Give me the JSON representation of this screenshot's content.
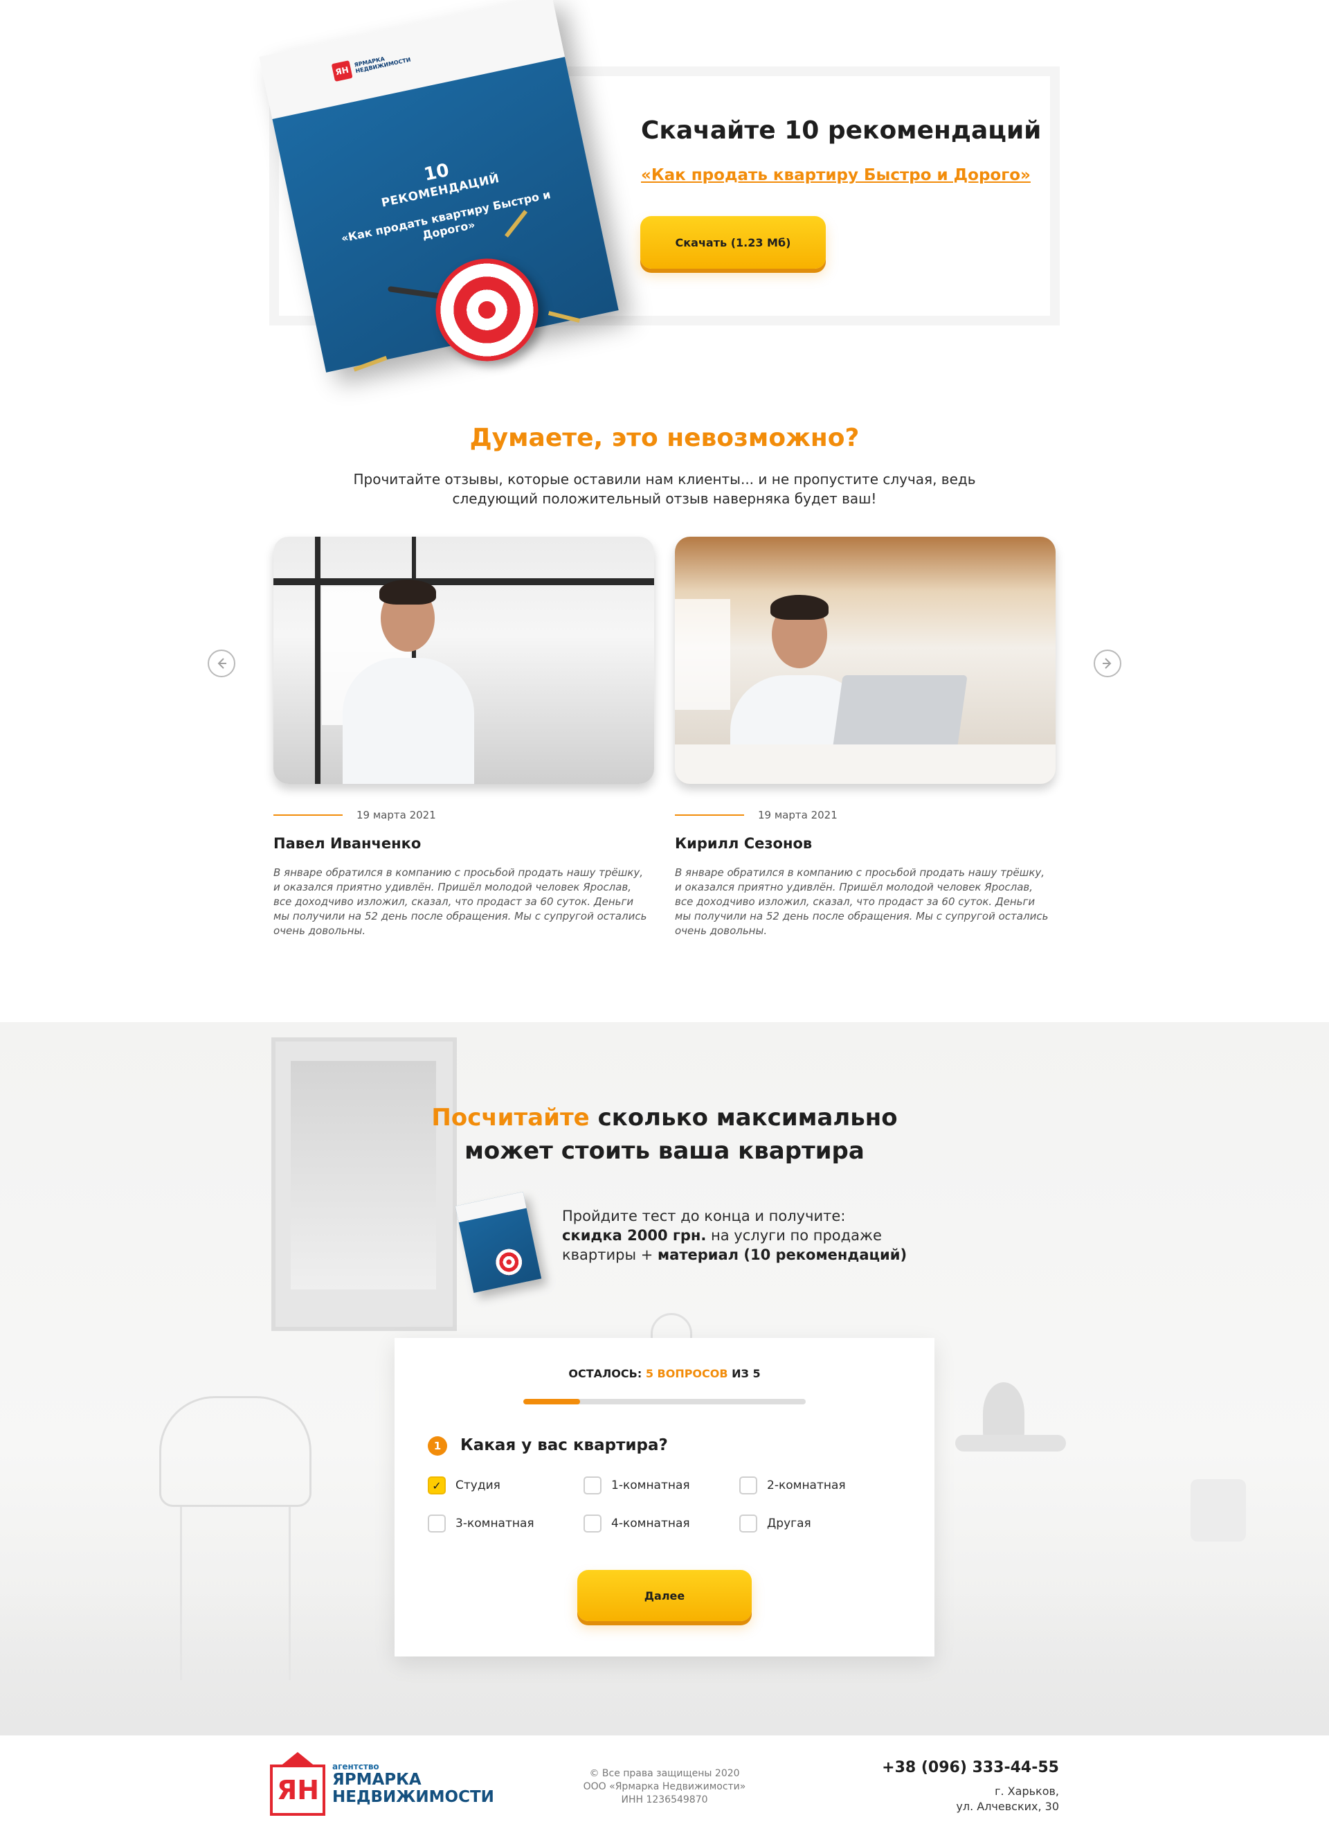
{
  "download": {
    "book": {
      "logo_letters": "ЯН",
      "logo_text": "ЯРМАРКА НЕДВИЖИМОСТИ",
      "number": "10",
      "heading": "РЕКОМЕНДАЦИЙ",
      "subtitle": "«Как продать квартиру Быстро и Дорого»"
    },
    "title": "Скачайте 10 рекомендаций",
    "link": "«Как продать квартиру Быстро и Дорого»",
    "button": "Скачать (1.23 Мб)"
  },
  "reviews": {
    "title": "Думаете, это невозможно?",
    "subtitle": "Прочитайте отзывы, которые оставили нам клиенты... и не пропустите случая, ведь следующий положительный отзыв наверняка будет ваш!",
    "prev_icon": "arrow-left-icon",
    "next_icon": "arrow-right-icon",
    "items": [
      {
        "date": "19 марта 2021",
        "name": "Павел Иванченко",
        "text": "В январе обратился в компанию с просьбой продать нашу трёшку, и оказался приятно удивлён. Пришёл молодой человек Ярослав, все доходчиво изложил, сказал, что продаст за 60 суток. Деньги мы получили на 52 день после обращения. Мы с супругой остались очень довольны."
      },
      {
        "date": "19 марта 2021",
        "name": "Кирилл Сезонов",
        "text": "В январе обратился в компанию с просьбой продать нашу трёшку, и оказался приятно удивлён. Пришёл молодой человек Ярослав, все доходчиво изложил, сказал, что продаст за 60 суток. Деньги мы получили на 52 день после обращения. Мы с супругой остались очень довольны."
      }
    ]
  },
  "quiz": {
    "title_orange": "Посчитайте",
    "title_rest_line1": " сколько максимально",
    "title_line2": "может стоить ваша квартира",
    "promo_line1": "Пройдите тест до конца и получите:",
    "promo_bold1": "скидка 2000 грн.",
    "promo_mid": " на услуги по продаже квартиры + ",
    "promo_bold2": "материал (10 рекомендаций)",
    "remain_prefix": "ОСТАЛОСЬ: ",
    "remain_count": "5 ВОПРОСОВ",
    "remain_suffix": " ИЗ 5",
    "progress_fraction": 0.2,
    "question_number": "1",
    "question": "Какая у вас квартира?",
    "options": [
      {
        "label": "Студия",
        "checked": true
      },
      {
        "label": "1-комнатная",
        "checked": false
      },
      {
        "label": "2-комнатная",
        "checked": false
      },
      {
        "label": "3-комнатная",
        "checked": false
      },
      {
        "label": "4-комнатная",
        "checked": false
      },
      {
        "label": "Другая",
        "checked": false
      }
    ],
    "check_glyph": "✓",
    "next_button": "Далее"
  },
  "footer": {
    "logo_letters": "ЯН",
    "logo_small": "агентство",
    "logo_line1": "ЯРМАРКА",
    "logo_line2": "НЕДВИЖИМОСТИ",
    "copyright": "© Все права защищены 2020",
    "company": "ООО «Ярмарка Недвижимости»",
    "inn": "ИНН 1236549870",
    "phone": "+38 (096) 333-44-55",
    "city": "г. Харьков,",
    "street": "ул. Алчевских, 30"
  },
  "colors": {
    "accent": "#f28c0a",
    "button": "#ffcc00",
    "brand_blue": "#14507f",
    "brand_red": "#e3262f"
  }
}
